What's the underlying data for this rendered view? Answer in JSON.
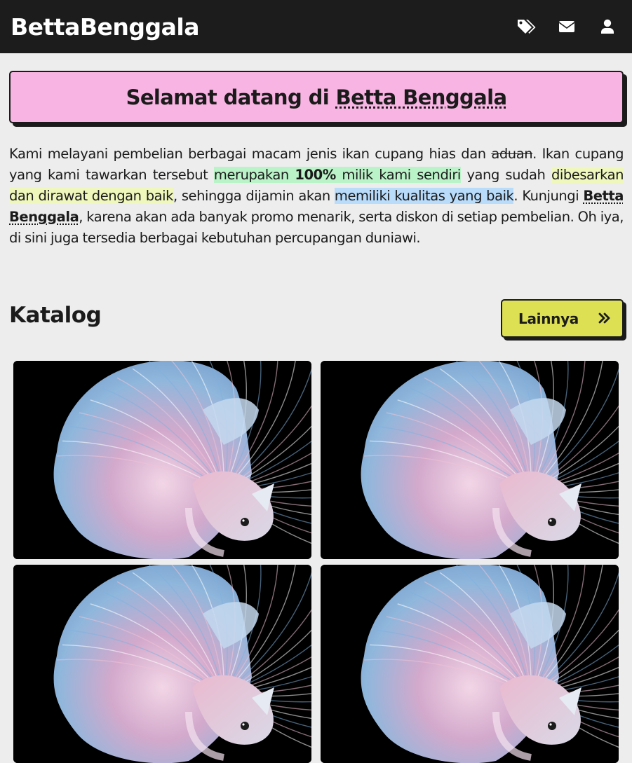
{
  "navbar": {
    "brand": "BettaBenggala",
    "icons": [
      "tags-icon",
      "envelope-icon",
      "user-icon"
    ],
    "background": "#1c1c1c"
  },
  "banner": {
    "prefix": "Selamat datang di ",
    "brand": "Betta Benggala",
    "background": "#f8b4e2"
  },
  "intro": {
    "p1": "Kami melayani pembelian berbagai macam jenis ikan cupang hias dan ",
    "strike": "aduan",
    "p2": ". Ikan cupang yang kami tawarkan tersebut ",
    "green_1": "merupakan ",
    "green_bold": "100%",
    "green_2": " milik kami sendiri",
    "p3": " yang sudah ",
    "yellow": "dibesarkan dan dirawat dengan baik",
    "p4": ", sehingga dijamin akan ",
    "blue": "memiliki kualitas yang baik",
    "p5": ". Kunjungi ",
    "brand": "Betta Benggala",
    "p6": ", karena akan ada banyak promo menarik, serta diskon di setiap pembelian. Oh iya, di sini juga tersedia berbagai kebutuhan percupangan duniawi."
  },
  "catalog": {
    "title": "Katalog",
    "more_label": "Lainnya",
    "more_icon": "double-chevron-right-icon",
    "button_color": "#dde052",
    "items": [
      "betta-fish-image",
      "betta-fish-image",
      "betta-fish-image",
      "betta-fish-image"
    ]
  }
}
